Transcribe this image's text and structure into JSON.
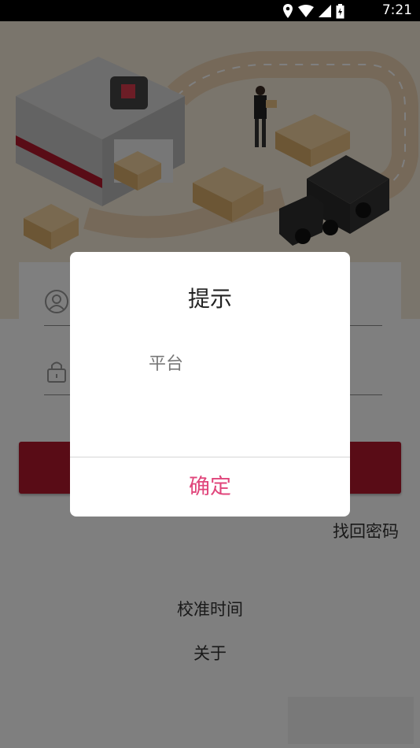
{
  "status_bar": {
    "time": "7:21",
    "icons": [
      "location-icon",
      "wifi-icon",
      "signal-icon",
      "battery-icon"
    ]
  },
  "links": {
    "recover_password": "找回密码",
    "calibrate_time": "校准时间",
    "about": "关于"
  },
  "dialog": {
    "title": "提示",
    "message": "平台",
    "confirm_label": "确定"
  },
  "colors": {
    "brand_red": "#b2182d",
    "dialog_button": "#e0457b",
    "banner_background": "#f4ead8"
  }
}
